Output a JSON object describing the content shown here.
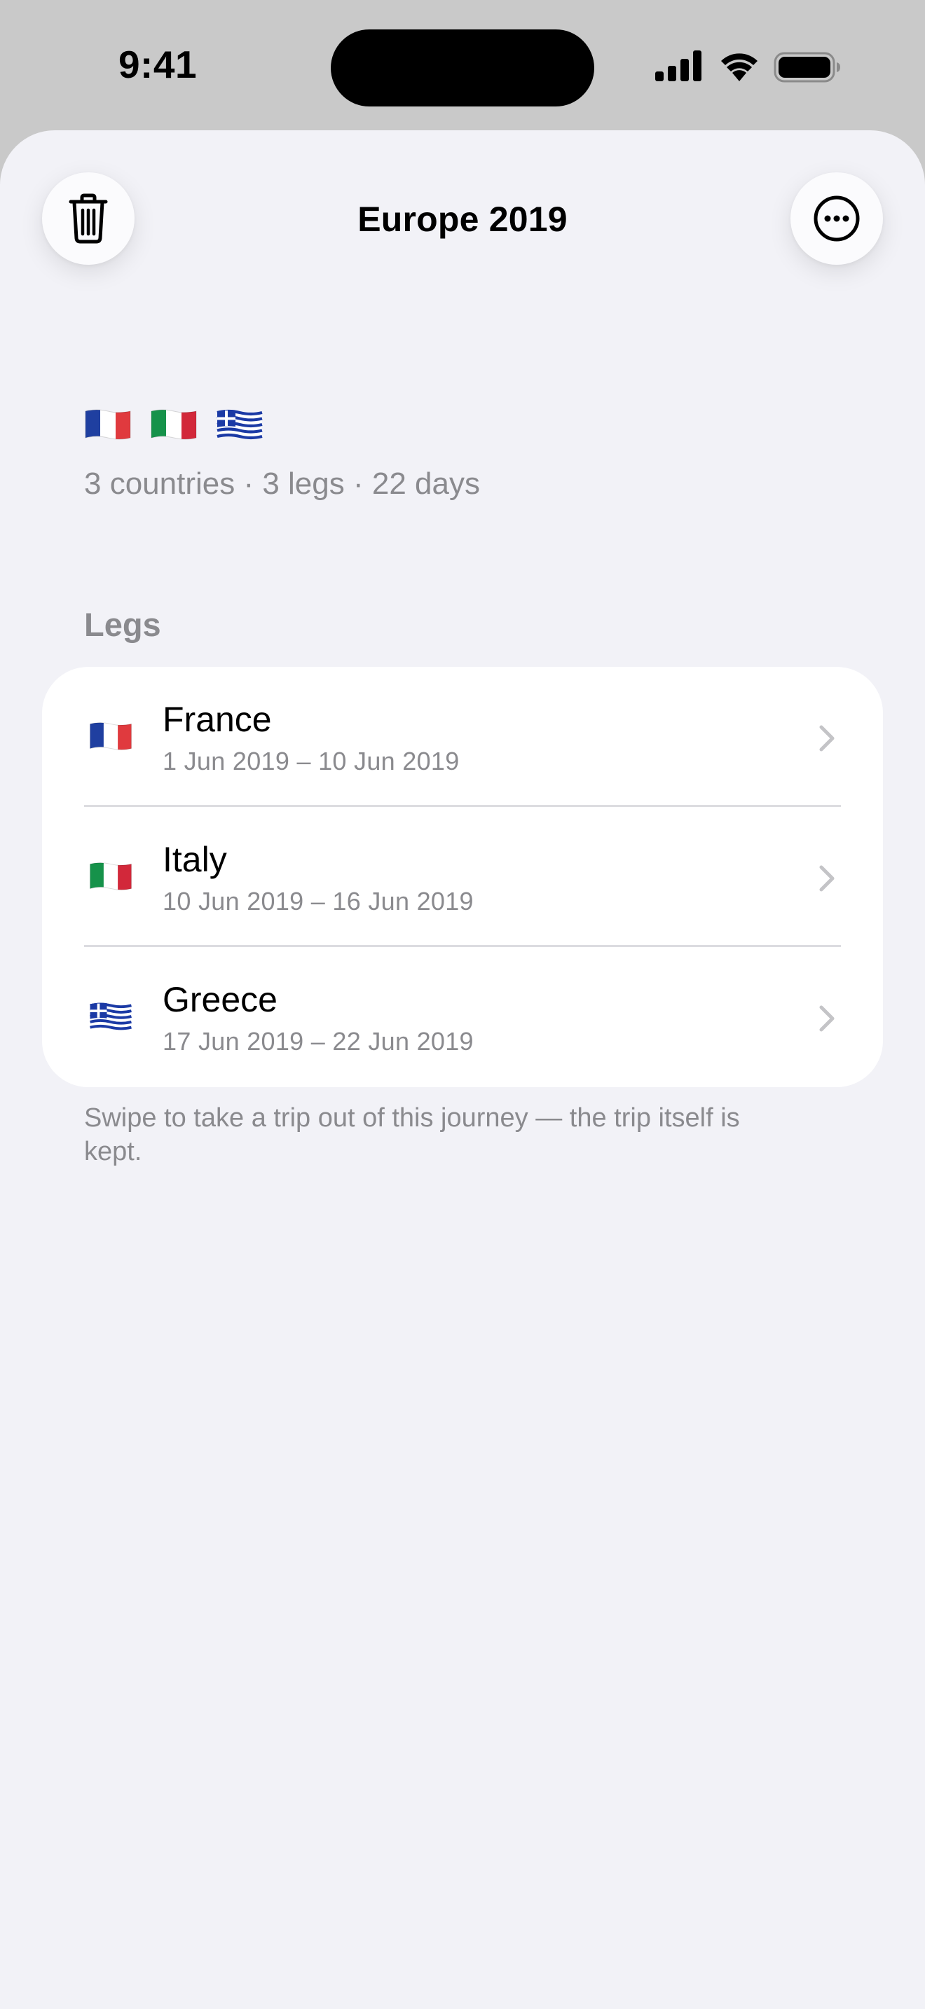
{
  "status_bar": {
    "time": "9:41",
    "icons": [
      "signal-icon",
      "wifi-icon",
      "battery-icon"
    ]
  },
  "header": {
    "title": "Europe 2019",
    "left_button_icon": "trash-icon",
    "right_button_icon": "ellipsis-circle-icon"
  },
  "summary": {
    "flags": [
      "france-flag",
      "italy-flag",
      "greece-flag"
    ],
    "text": "3 countries · 3 legs · 22 days"
  },
  "legs_section": {
    "header": "Legs",
    "items": [
      {
        "flag": "france-flag",
        "name": "France",
        "dates": "1 Jun 2019 – 10 Jun 2019"
      },
      {
        "flag": "italy-flag",
        "name": "Italy",
        "dates": "10 Jun 2019 – 16 Jun 2019"
      },
      {
        "flag": "greece-flag",
        "name": "Greece",
        "dates": "17 Jun 2019 – 22 Jun 2019"
      }
    ],
    "footer": "Swipe to take a trip out of this journey — the trip itself is kept."
  },
  "colors": {
    "background": "#f2f2f7",
    "secondary_text": "#8a8a8e",
    "card": "#ffffff",
    "france_blue": "#1f3fa0",
    "france_red": "#e03a3e",
    "italy_green": "#16924a",
    "italy_red": "#d2283a",
    "greece_blue": "#1b3aa5"
  }
}
